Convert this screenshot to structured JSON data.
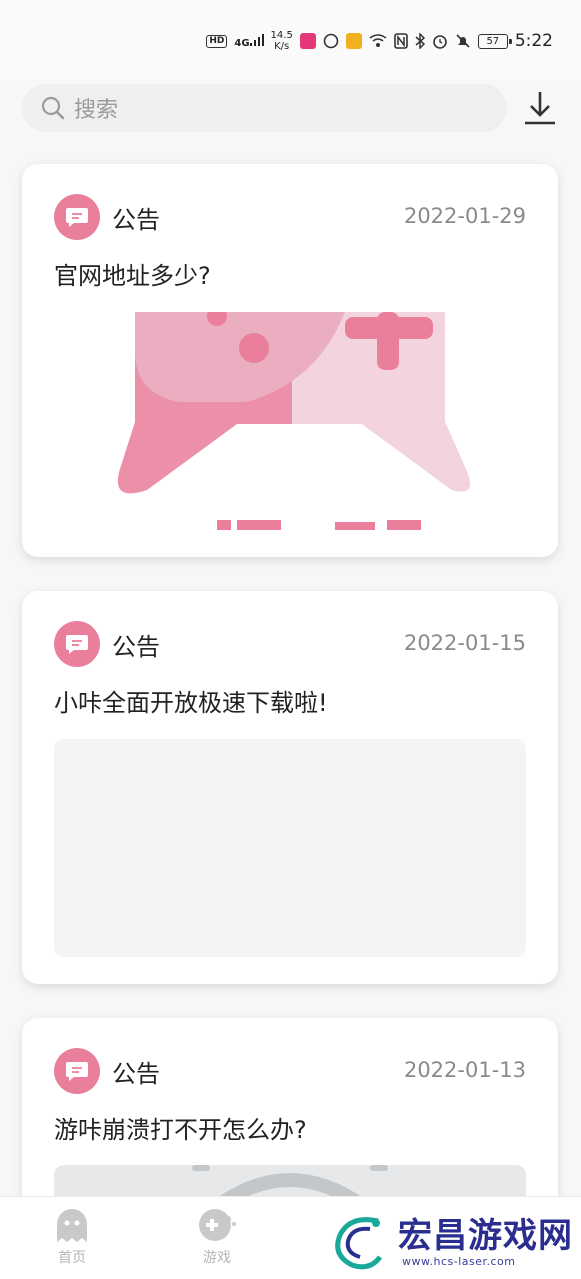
{
  "status_bar": {
    "hd": "HD",
    "signal": "4G",
    "speed_value": "14.5",
    "speed_unit": "K/s",
    "battery": "57",
    "time": "5:22"
  },
  "search": {
    "placeholder": "搜索"
  },
  "cards": [
    {
      "label": "公告",
      "date": "2022-01-29",
      "title": "官网地址多少?"
    },
    {
      "label": "公告",
      "date": "2022-01-15",
      "title": "小咔全面开放极速下载啦!"
    },
    {
      "label": "公告",
      "date": "2022-01-13",
      "title": "游咔崩溃打不开怎么办?"
    }
  ],
  "bottom_nav": [
    {
      "label": "首页",
      "icon": "ghost-icon"
    },
    {
      "label": "游戏",
      "icon": "gamepad-icon"
    }
  ],
  "watermark": {
    "main": "宏昌游戏网",
    "url": "www.hcs-laser.com"
  },
  "colors": {
    "accent": "#e97f9b",
    "pink_light": "#f3d3de",
    "pink_mid": "#ebadc0"
  }
}
